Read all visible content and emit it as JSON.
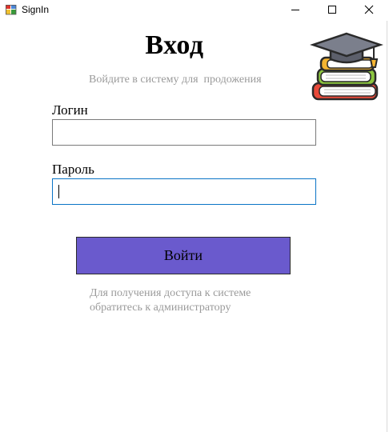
{
  "window": {
    "title": "SignIn"
  },
  "icons": {
    "app": "winforms-app-icon",
    "minimize": "minimize-icon",
    "maximize": "maximize-icon",
    "close": "close-icon",
    "logo": "graduation-cap-books-logo"
  },
  "header": {
    "title": "Вход",
    "subtitle": "Войдите в систему для  продожения"
  },
  "form": {
    "login_label": "Логин",
    "login_value": "",
    "password_label": "Пароль",
    "password_value": "",
    "submit_label": "Войти"
  },
  "hint": {
    "line1": "Для получения доступа к системе",
    "line2": "обратитесь к администратору"
  },
  "colors": {
    "button": "#6a5acd",
    "focus_border": "#0a74c6",
    "muted_text": "#9a9a9a"
  }
}
